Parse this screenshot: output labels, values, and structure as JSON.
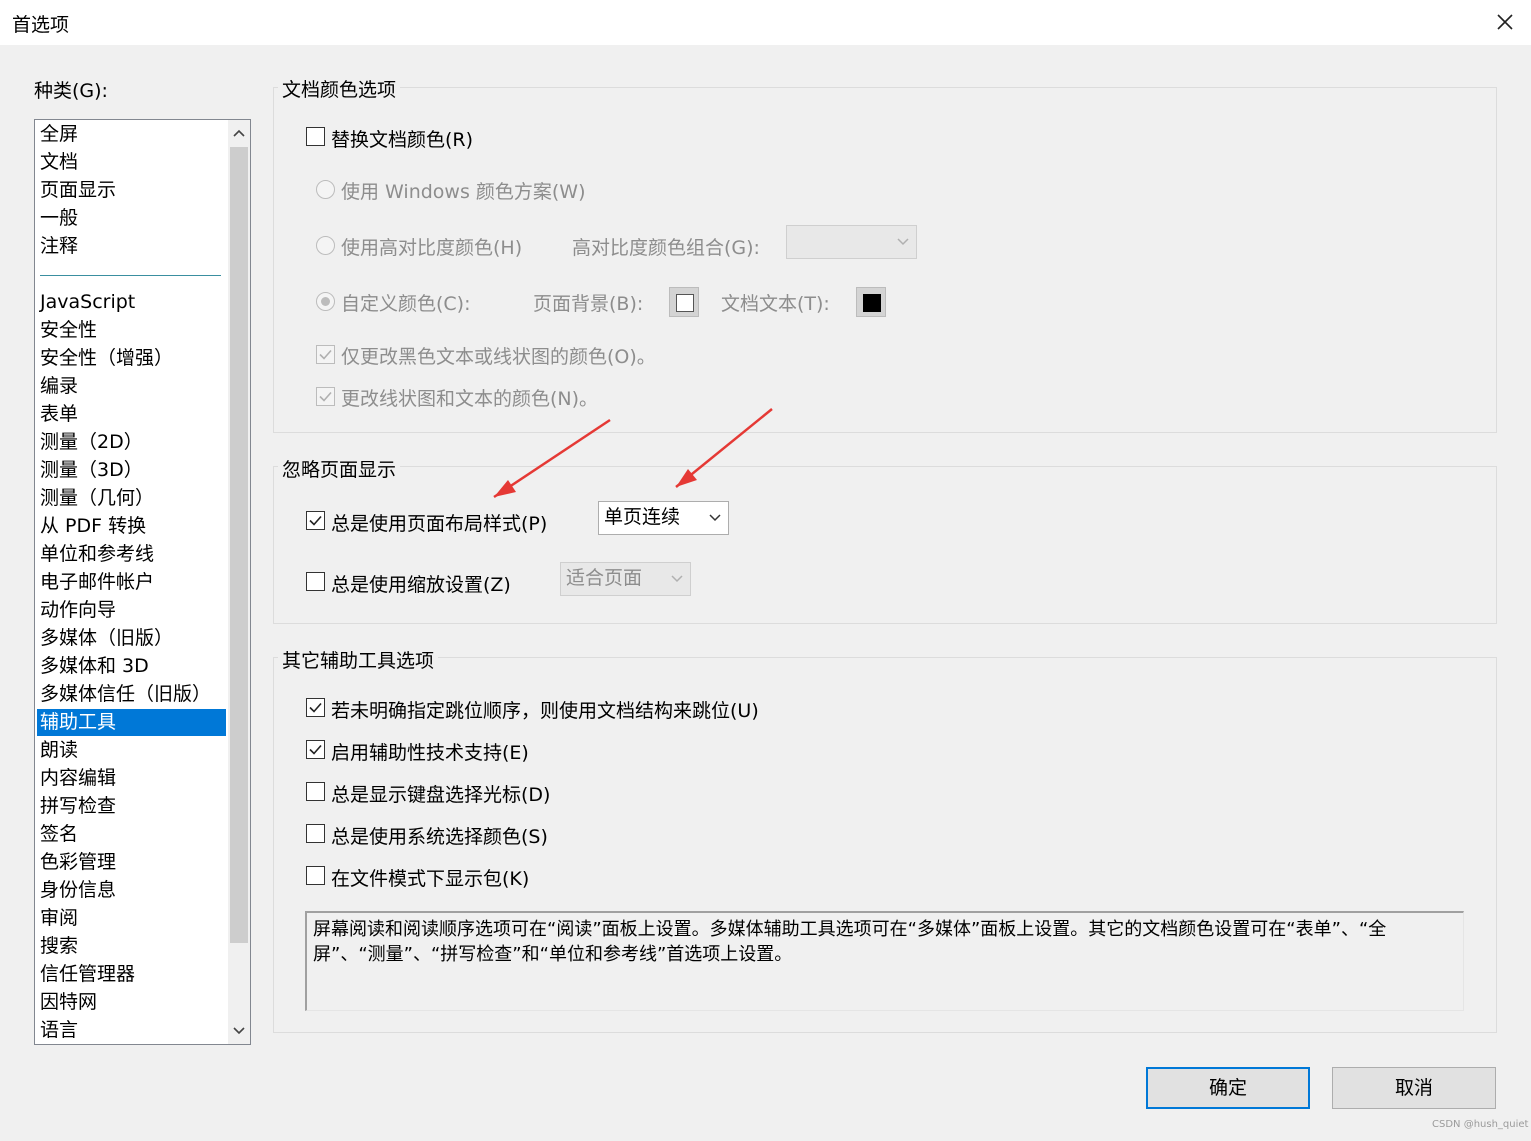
{
  "window": {
    "title": "首选项"
  },
  "categories": {
    "label": "种类(G):",
    "group1": [
      "全屏",
      "文档",
      "页面显示",
      "一般",
      "注释"
    ],
    "group2": [
      "JavaScript",
      "安全性",
      "安全性（增强）",
      "编录",
      "表单",
      "测量（2D）",
      "测量（3D）",
      "测量（几何）",
      "从 PDF 转换",
      "单位和参考线",
      "电子邮件帐户",
      "动作向导",
      "多媒体（旧版）",
      "多媒体和 3D",
      "多媒体信任（旧版）",
      "辅助工具",
      "朗读",
      "内容编辑",
      "拼写检查",
      "签名",
      "色彩管理",
      "身份信息",
      "审阅",
      "搜索",
      "信任管理器",
      "因特网",
      "语言"
    ],
    "selected": "辅助工具"
  },
  "doc_colors": {
    "title": "文档颜色选项",
    "replace_colors": {
      "label": "替换文档颜色(R)",
      "checked": false
    },
    "windows_scheme": {
      "label": "使用 Windows 颜色方案(W)"
    },
    "high_contrast": {
      "label": "使用高对比度颜色(H)",
      "combo_label": "高对比度颜色组合(G):",
      "combo_value": ""
    },
    "custom": {
      "label": "自定义颜色(C):",
      "page_bg_label": "页面背景(B):",
      "page_bg_color": "#ffffff",
      "doc_text_label": "文档文本(T):",
      "doc_text_color": "#000000"
    },
    "only_black": {
      "label": "仅更改黑色文本或线状图的颜色(O)。",
      "checked": true
    },
    "change_line_art": {
      "label": "更改线状图和文本的颜色(N)。",
      "checked": true
    }
  },
  "override_display": {
    "title": "忽略页面显示",
    "page_layout": {
      "label": "总是使用页面布局样式(P)",
      "checked": true,
      "value": "单页连续"
    },
    "zoom": {
      "label": "总是使用缩放设置(Z)",
      "checked": false,
      "value": "适合页面"
    }
  },
  "other_options": {
    "title": "其它辅助工具选项",
    "items": [
      {
        "label": "若未明确指定跳位顺序，则使用文档结构来跳位(U)",
        "checked": true
      },
      {
        "label": "启用辅助性技术支持(E)",
        "checked": true
      },
      {
        "label": "总是显示键盘选择光标(D)",
        "checked": false
      },
      {
        "label": "总是使用系统选择颜色(S)",
        "checked": false
      },
      {
        "label": "在文件模式下显示包(K)",
        "checked": false
      }
    ],
    "info": "屏幕阅读和阅读顺序选项可在“阅读”面板上设置。多媒体辅助工具选项可在“多媒体”面板上设置。其它的文档颜色设置可在“表单”、“全屏”、“测量”、“拼写检查”和“单位和参考线”首选项上设置。"
  },
  "buttons": {
    "ok": "确定",
    "cancel": "取消"
  },
  "watermark": "CSDN @hush_quiet",
  "colors": {
    "accent": "#0078d7",
    "annotation_arrow": "#e53935"
  }
}
